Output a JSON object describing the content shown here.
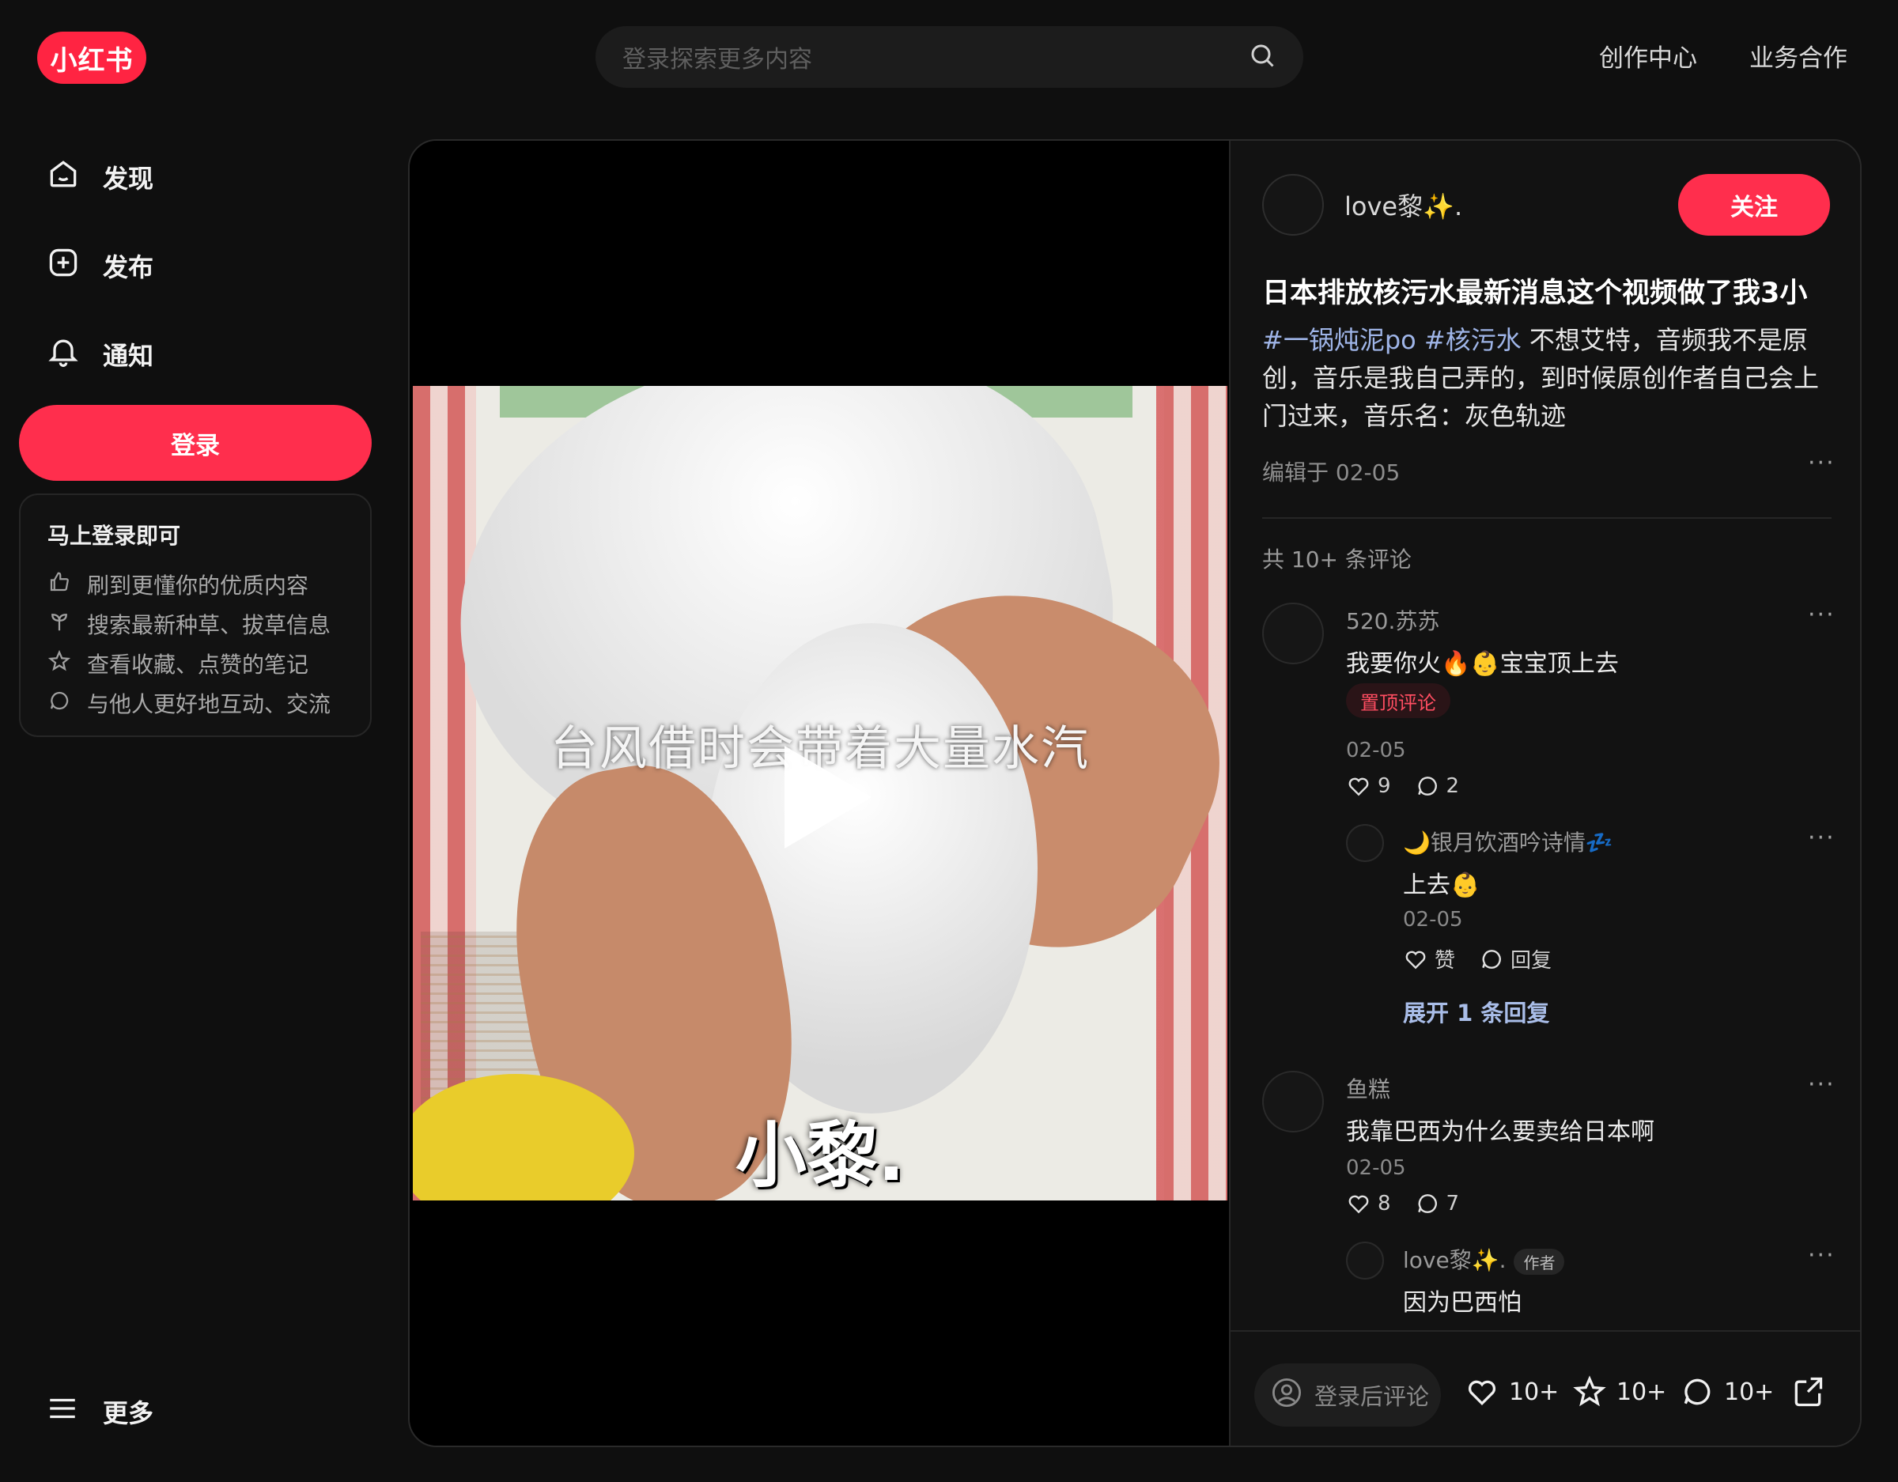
{
  "brand": {
    "logo_text": "小红书",
    "color": "#ff2442"
  },
  "search": {
    "placeholder": "登录探索更多内容"
  },
  "top_links": [
    "创作中心",
    "业务合作"
  ],
  "sidebar": {
    "nav": [
      {
        "label": "发现",
        "icon": "home-icon"
      },
      {
        "label": "发布",
        "icon": "plus-square-icon"
      },
      {
        "label": "通知",
        "icon": "bell-icon"
      }
    ],
    "login_button": "登录",
    "login_card": {
      "title": "马上登录即可",
      "items": [
        {
          "text": "刷到更懂你的优质内容",
          "icon": "thumb-up-icon"
        },
        {
          "text": "搜索最新种草、拔草信息",
          "icon": "sprout-icon"
        },
        {
          "text": "查看收藏、点赞的笔记",
          "icon": "star-icon"
        },
        {
          "text": "与他人更好地互动、交流",
          "icon": "chat-icon"
        }
      ]
    },
    "more": "更多"
  },
  "video": {
    "caption": "台风借时会带着大量水汽",
    "watermark": "小黎."
  },
  "note": {
    "author": "love黎✨.",
    "follow": "关注",
    "title": "日本排放核污水最新消息这个视频做了我3小",
    "tags": [
      "#一锅炖泥po",
      "#核污水"
    ],
    "body": "不想艾特，音频我不是原创，音乐是我自己弄的，到时候原创作者自己会上门过来，音乐名：灰色轨迹",
    "edited": "编辑于 02-05",
    "comment_count": "共 10+ 条评论"
  },
  "comments": [
    {
      "name": "520.苏苏",
      "text": "我要你火🔥👶宝宝顶上去",
      "badge": "置顶评论",
      "date": "02-05",
      "likes": "9",
      "replies": "2",
      "reply": {
        "name": "🌙银月饮酒吟诗情💤",
        "text": "上去👶",
        "date": "02-05",
        "like_label": "赞",
        "reply_label": "回复"
      },
      "expand": "展开 1 条回复"
    },
    {
      "name": "鱼糕",
      "text": "我靠巴西为什么要卖给日本啊",
      "date": "02-05",
      "likes": "8",
      "replies": "7",
      "reply": {
        "name": "love黎✨.",
        "author_badge": "作者",
        "text": "因为巴西怕"
      }
    }
  ],
  "bottom_bar": {
    "comment_placeholder": "登录后评论",
    "likes": "10+",
    "collects": "10+",
    "comments": "10+"
  },
  "colors": {
    "accent": "#ff2e4d",
    "tag": "#9fb5e8",
    "background": "#0f0f0f"
  }
}
